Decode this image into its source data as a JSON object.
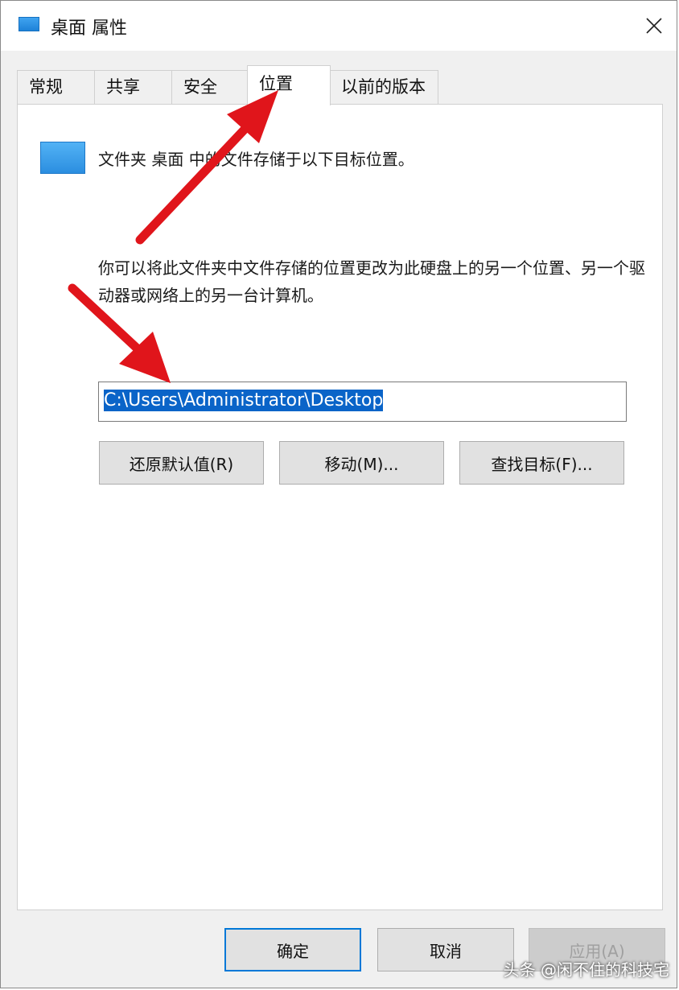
{
  "window": {
    "title": "桌面 属性"
  },
  "tabs": [
    {
      "label": "常规"
    },
    {
      "label": "共享"
    },
    {
      "label": "安全"
    },
    {
      "label": "位置"
    },
    {
      "label": "以前的版本"
    }
  ],
  "location_tab": {
    "description": "文件夹 桌面 中的文件存储于以下目标位置。",
    "info": "你可以将此文件夹中文件存储的位置更改为此硬盘上的另一个位置、另一个驱动器或网络上的另一台计算机。",
    "path_value": "C:\\Users\\Administrator\\Desktop",
    "buttons": {
      "restore_default": "还原默认值(R)",
      "move": "移动(M)...",
      "find_target": "查找目标(F)..."
    }
  },
  "footer": {
    "ok": "确定",
    "cancel": "取消",
    "apply": "应用(A)"
  },
  "watermark": "头条 @闲不住的科技宅",
  "colors": {
    "accent": "#0078d7",
    "selection": "#0a64c8",
    "annotation_arrow": "#e0151b"
  },
  "icons": {
    "title_icon": "folder-icon",
    "close": "close-icon"
  }
}
